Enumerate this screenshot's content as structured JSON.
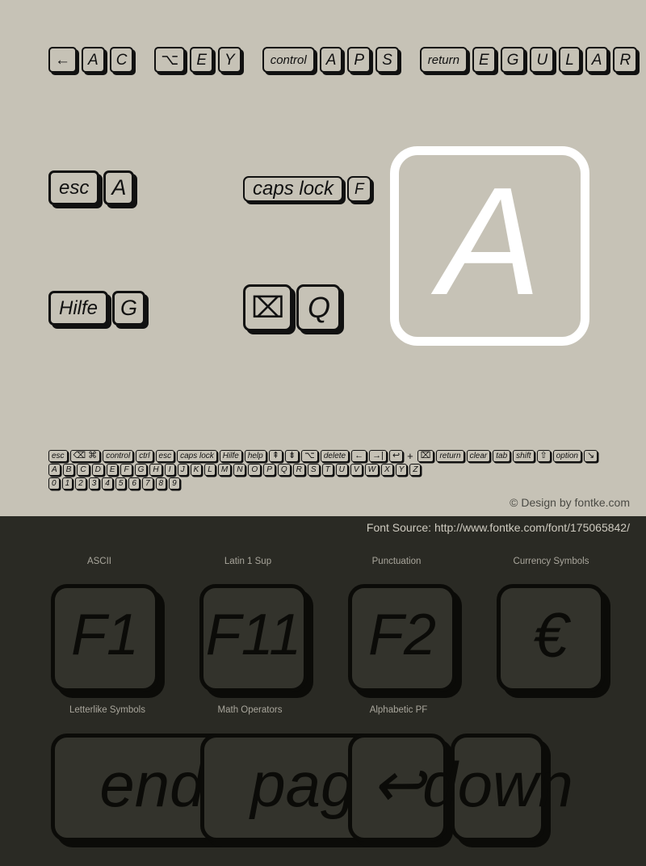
{
  "page": {
    "background_light": "#c6c2b6",
    "background_dark": "#2a2a24",
    "accent_white": "#ffffff"
  },
  "banner_row": {
    "keys": [
      {
        "label": "←",
        "style": "glyph"
      },
      {
        "label": "A",
        "style": "letter"
      },
      {
        "label": "C",
        "style": "letter"
      },
      {
        "label": "⌥",
        "style": "glyph"
      },
      {
        "label": "E",
        "style": "letter"
      },
      {
        "label": "Y",
        "style": "letter"
      },
      {
        "label": "control",
        "style": "word"
      },
      {
        "label": "A",
        "style": "letter"
      },
      {
        "label": "P",
        "style": "letter"
      },
      {
        "label": "S",
        "style": "letter"
      },
      {
        "label": "return",
        "style": "word"
      },
      {
        "label": "E",
        "style": "letter"
      },
      {
        "label": "G",
        "style": "letter"
      },
      {
        "label": "U",
        "style": "letter"
      },
      {
        "label": "L",
        "style": "letter"
      },
      {
        "label": "A",
        "style": "letter"
      },
      {
        "label": "R",
        "style": "letter"
      }
    ]
  },
  "sample_rows": {
    "esc_pair": [
      "esc",
      "A"
    ],
    "capslock_pair": [
      "caps lock",
      "F"
    ],
    "hilfe_pair": [
      "Hilfe",
      "G"
    ],
    "symbol_pair": [
      "⌧",
      "Q"
    ]
  },
  "big_key": {
    "letter": "A"
  },
  "tiny_strip": {
    "line1": [
      "esc",
      "⌫ ⌘",
      "control",
      "ctrl",
      "esc",
      "caps lock",
      "Hilfe",
      "help",
      "⇞",
      "⇟",
      "⌥",
      "delete",
      "←",
      "→|",
      "↩",
      "+",
      "⌧",
      "return",
      "clear",
      "tab",
      "shift",
      "⇧",
      "option",
      "↘"
    ],
    "line2": [
      "A",
      "B",
      "C",
      "D",
      "E",
      "F",
      "G",
      "H",
      "I",
      "J",
      "K",
      "L",
      "M",
      "N",
      "O",
      "P",
      "Q",
      "R",
      "S",
      "T",
      "U",
      "V",
      "W",
      "X",
      "Y",
      "Z"
    ],
    "line3": [
      "0",
      "1",
      "2",
      "3",
      "4",
      "5",
      "6",
      "7",
      "8",
      "9"
    ]
  },
  "footer": {
    "copyright": "© Design by fontke.com",
    "source": "Font Source: http://www.fontke.com/font/175065842/"
  },
  "unicode_blocks": {
    "row1": [
      {
        "label": "ASCII",
        "sample": "F1"
      },
      {
        "label": "Latin 1 Sup",
        "sample": "F11"
      },
      {
        "label": "Punctuation",
        "sample": "F2"
      },
      {
        "label": "Currency Symbols",
        "sample": "€"
      }
    ],
    "row2": [
      {
        "label": "Letterlike Symbols",
        "sample": "end"
      },
      {
        "label": "Math Operators",
        "sample": "page"
      },
      {
        "label": "Alphabetic PF",
        "sample": "↩"
      },
      {
        "label": "",
        "sample": "down"
      }
    ]
  }
}
